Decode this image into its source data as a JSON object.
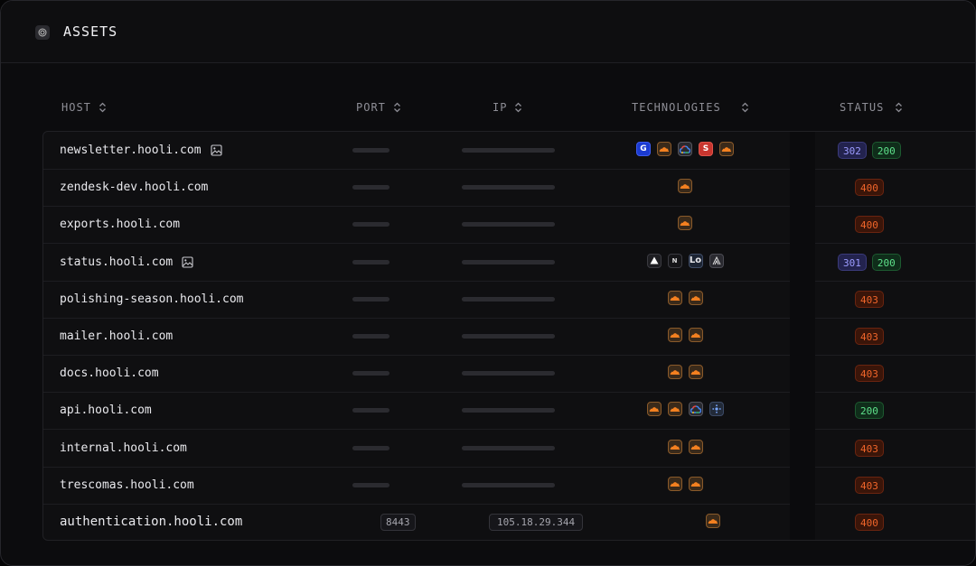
{
  "title": "ASSETS",
  "columns": {
    "host": "HOST",
    "port": "PORT",
    "ip": "IP",
    "technologies": "TECHNOLOGIES",
    "status": "STATUS"
  },
  "rows": [
    {
      "host": "newsletter.hooli.com",
      "screenshot": true,
      "techs": [
        "blue-g-icon",
        "cloudflare-icon",
        "google-cloud-icon",
        "red-s-icon",
        "cloudflare-icon"
      ],
      "status": [
        "302",
        "200"
      ]
    },
    {
      "host": "zendesk-dev.hooli.com",
      "screenshot": false,
      "techs": [
        "cloudflare-icon"
      ],
      "status": [
        "400"
      ]
    },
    {
      "host": "exports.hooli.com",
      "screenshot": false,
      "techs": [
        "cloudflare-icon"
      ],
      "status": [
        "400"
      ]
    },
    {
      "host": "status.hooli.com",
      "screenshot": true,
      "techs": [
        "vercel-icon",
        "nextjs-icon",
        "lo-icon",
        "stripes-icon"
      ],
      "status": [
        "301",
        "200"
      ]
    },
    {
      "host": "polishing-season.hooli.com",
      "screenshot": false,
      "techs": [
        "cloudflare-icon",
        "cloudflare-icon"
      ],
      "status": [
        "403"
      ]
    },
    {
      "host": "mailer.hooli.com",
      "screenshot": false,
      "techs": [
        "cloudflare-icon",
        "cloudflare-icon"
      ],
      "status": [
        "403"
      ]
    },
    {
      "host": "docs.hooli.com",
      "screenshot": false,
      "techs": [
        "cloudflare-icon",
        "cloudflare-icon"
      ],
      "status": [
        "403"
      ]
    },
    {
      "host": "api.hooli.com",
      "screenshot": false,
      "techs": [
        "cloudflare-icon",
        "cloudflare-icon",
        "google-cloud-icon",
        "network-icon"
      ],
      "status": [
        "200"
      ]
    },
    {
      "host": "internal.hooli.com",
      "screenshot": false,
      "techs": [
        "cloudflare-icon",
        "cloudflare-icon"
      ],
      "status": [
        "403"
      ]
    },
    {
      "host": "trescomas.hooli.com",
      "screenshot": false,
      "techs": [
        "cloudflare-icon",
        "cloudflare-icon"
      ],
      "status": [
        "403"
      ]
    },
    {
      "host": "authentication.hooli.com",
      "screenshot": false,
      "port": "8443",
      "ip": "105.18.29.344",
      "techs": [
        "cloudflare-icon"
      ],
      "status": [
        "400"
      ]
    }
  ],
  "colors": {
    "status_3xx": "#9c9cff",
    "status_2xx": "#5ee08a",
    "status_4xx": "#f0652a",
    "cloudflare": "#f38020"
  }
}
